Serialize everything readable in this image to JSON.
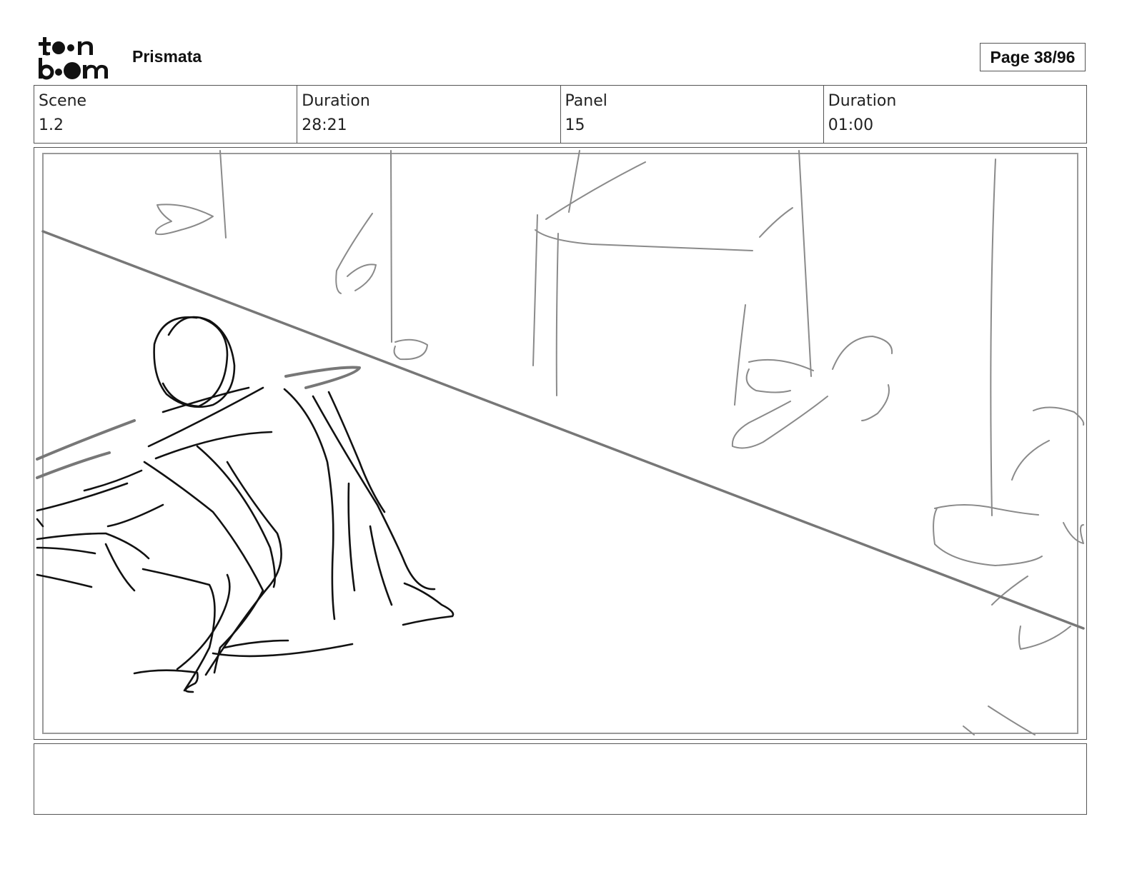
{
  "header": {
    "brand_logo": "toonboom-logo",
    "brand_name": "toon boom",
    "project_title": "Prismata",
    "page_label": "Page 38/96"
  },
  "info_table": [
    {
      "label": "Scene",
      "value": "1.2"
    },
    {
      "label": "Duration",
      "value": "28:21"
    },
    {
      "label": "Panel",
      "value": "15"
    },
    {
      "label": "Duration",
      "value": "01:00"
    }
  ],
  "panel": {
    "image": "rough-storyboard-sketch"
  },
  "notes": {
    "text": ""
  }
}
